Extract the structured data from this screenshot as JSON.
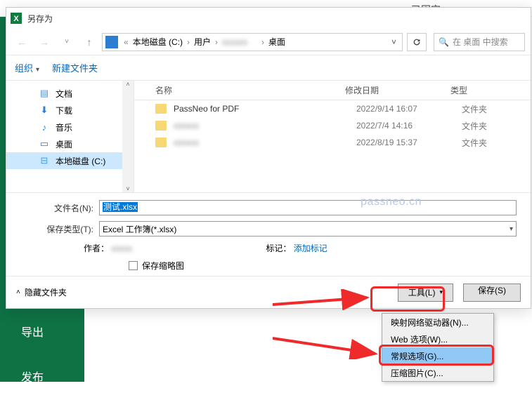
{
  "excel_sidebar": {
    "export": "导出",
    "publish": "发布",
    "pinned": "已固定"
  },
  "dialog": {
    "title": "另存为",
    "breadcrumb": [
      "本地磁盘 (C:)",
      "用户",
      "",
      "桌面"
    ],
    "search_placeholder": "在 桌面 中搜索",
    "toolbar": {
      "organize": "组织",
      "new_folder": "新建文件夹"
    },
    "sidebar_items": [
      {
        "icon": "doc",
        "label": "文档"
      },
      {
        "icon": "dl",
        "label": "下载"
      },
      {
        "icon": "mus",
        "label": "音乐"
      },
      {
        "icon": "dsk",
        "label": "桌面"
      },
      {
        "icon": "drv",
        "label": "本地磁盘 (C:)"
      }
    ],
    "columns": {
      "name": "名称",
      "date": "修改日期",
      "type": "类型"
    },
    "rows": [
      {
        "name": "PassNeo for PDF",
        "date": "2022/9/14 16:07",
        "type": "文件夹",
        "blur": false
      },
      {
        "name": "xxxxxx",
        "date": "2022/7/4 14:16",
        "type": "文件夹",
        "blur": true
      },
      {
        "name": "xxxxxx",
        "date": "2022/8/19 15:37",
        "type": "文件夹",
        "blur": true
      }
    ],
    "form": {
      "filename_label": "文件名(N):",
      "filename_value": "测试.xlsx",
      "filetype_label": "保存类型(T):",
      "filetype_value": "Excel 工作簿(*.xlsx)",
      "author_label": "作者：",
      "tags_label": "标记：",
      "tags_value": "添加标记",
      "thumb_label": "保存缩略图"
    },
    "watermark": "passneo.cn",
    "footer": {
      "hide": "隐藏文件夹",
      "tools": "工具(L)",
      "save": "保存(S)"
    },
    "tools_menu": [
      "映射网络驱动器(N)...",
      "Web 选项(W)...",
      "常规选项(G)...",
      "压缩图片(C)..."
    ]
  }
}
